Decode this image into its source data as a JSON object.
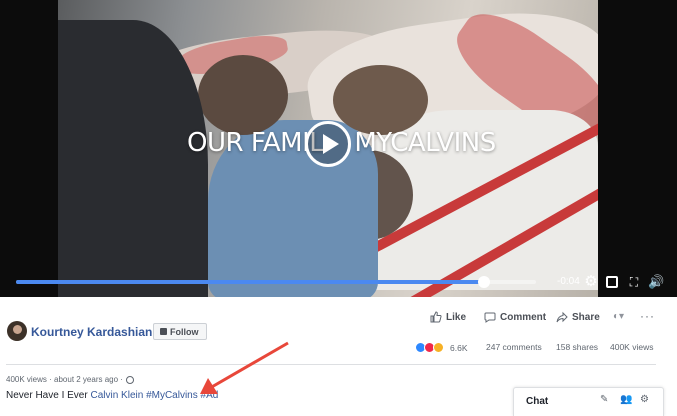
{
  "video": {
    "overlay_text": "OUR FAMIL    MYCALVINS",
    "time_remaining": "-0:04",
    "progress_fraction": 0.9,
    "accent_color": "#4b89f0"
  },
  "post": {
    "page_name": "Kourtney Kardashian",
    "follow_label": "Follow",
    "actions": {
      "like": "Like",
      "comment": "Comment",
      "share": "Share"
    },
    "more": "···",
    "reaction_count": "6.6K",
    "comments_count": "247 comments",
    "shares_count": "158 shares",
    "views_count": "400K views",
    "meta": "400K views · about 2 years ago ·",
    "caption_plain": "Never Have I Ever ",
    "caption_links": "Calvin Klein #MyCalvins #Ad",
    "link_color": "#365899"
  },
  "chat": {
    "title": "Chat"
  },
  "annotation": {
    "arrow_color": "#e8473a"
  }
}
